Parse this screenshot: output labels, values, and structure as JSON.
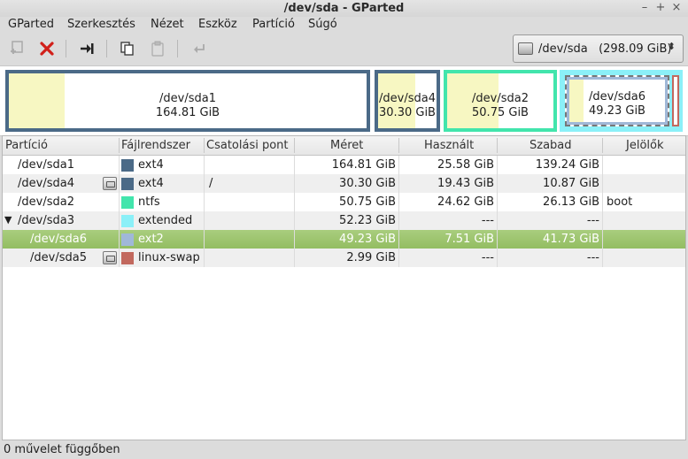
{
  "window": {
    "title": "/dev/sda - GParted",
    "minimize": "–",
    "maximize": "+",
    "close": "×"
  },
  "menubar": [
    "GParted",
    "Szerkesztés",
    "Nézet",
    "Eszköz",
    "Partíció",
    "Súgó"
  ],
  "device_selector": {
    "label": "/dev/sda   (298.09 GiB)",
    "arrow": "▲▼"
  },
  "map": [
    {
      "name": "/dev/sda1",
      "size": "164.81 GiB",
      "color": "#4b6a87",
      "used_fraction": 0.155
    },
    {
      "name": "/dev/sda4",
      "size": "30.30 GiB",
      "color": "#4b6a87",
      "used_fraction": 0.64
    },
    {
      "name": "/dev/sda2",
      "size": "50.75 GiB",
      "color": "#42e5ac",
      "used_fraction": 0.485
    },
    {
      "name": "/dev/sda6",
      "size": "49.23 GiB",
      "color": "#a0b8d8",
      "used_fraction": 0.15
    },
    {
      "name": "",
      "size": "",
      "color": "#c2695e",
      "used_fraction": 0
    }
  ],
  "extended_color": "#8bf0f8",
  "columns": [
    "Partíció",
    "Fájlrendszer",
    "Csatolási pont",
    "Méret",
    "Használt",
    "Szabad",
    "Jelölők"
  ],
  "rows": [
    {
      "partition": "/dev/sda1",
      "fs": "ext4",
      "color": "#4b6a87",
      "mount": "",
      "size": "164.81 GiB",
      "used": "25.58 GiB",
      "free": "139.24 GiB",
      "flags": "",
      "lock": false,
      "expander": "",
      "indent": false
    },
    {
      "partition": "/dev/sda4",
      "fs": "ext4",
      "color": "#4b6a87",
      "mount": "/",
      "size": "30.30 GiB",
      "used": "19.43 GiB",
      "free": "10.87 GiB",
      "flags": "",
      "lock": true,
      "expander": "",
      "indent": false
    },
    {
      "partition": "/dev/sda2",
      "fs": "ntfs",
      "color": "#42e5ac",
      "mount": "",
      "size": "50.75 GiB",
      "used": "24.62 GiB",
      "free": "26.13 GiB",
      "flags": "boot",
      "lock": false,
      "expander": "",
      "indent": false
    },
    {
      "partition": "/dev/sda3",
      "fs": "extended",
      "color": "#8bf0f8",
      "mount": "",
      "size": "52.23 GiB",
      "used": "---",
      "free": "---",
      "flags": "",
      "lock": false,
      "expander": "▼",
      "indent": false
    },
    {
      "partition": "/dev/sda6",
      "fs": "ext2",
      "color": "#a0b8d8",
      "mount": "",
      "size": "49.23 GiB",
      "used": "7.51 GiB",
      "free": "41.73 GiB",
      "flags": "",
      "lock": false,
      "expander": "",
      "indent": true,
      "selected": true
    },
    {
      "partition": "/dev/sda5",
      "fs": "linux-swap",
      "color": "#c2695e",
      "mount": "",
      "size": "2.99 GiB",
      "used": "---",
      "free": "---",
      "flags": "",
      "lock": true,
      "expander": "",
      "indent": true
    }
  ],
  "status": "0 művelet függőben"
}
